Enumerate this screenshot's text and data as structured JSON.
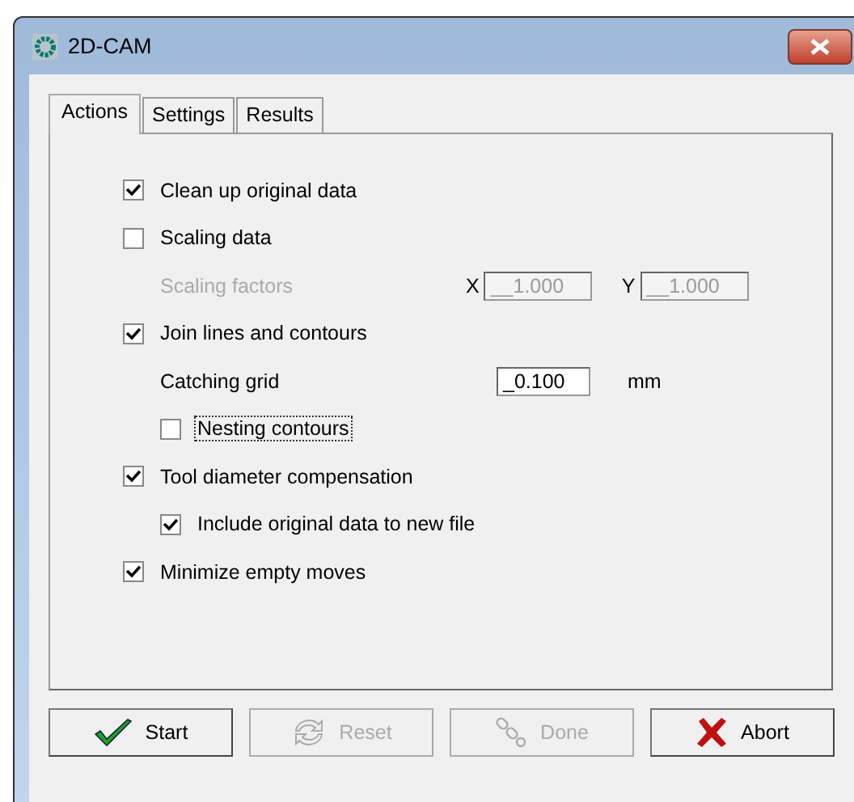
{
  "window": {
    "title": "2D-CAM"
  },
  "tabs": [
    {
      "label": "Actions",
      "selected": true
    },
    {
      "label": "Settings",
      "selected": false
    },
    {
      "label": "Results",
      "selected": false
    }
  ],
  "options": [
    {
      "kind": "checkbox",
      "label": "Clean up original data",
      "checked": true
    },
    {
      "kind": "checkbox",
      "label": "Scaling data",
      "checked": false
    },
    {
      "kind": "pair",
      "label": "Scaling factors",
      "disabled": true,
      "fields": [
        {
          "label": "X",
          "value": "__1.000"
        },
        {
          "label": "Y",
          "value": "__1.000"
        }
      ]
    },
    {
      "kind": "checkbox",
      "label": "Join lines and contours",
      "checked": true,
      "children": [
        {
          "kind": "field",
          "label": "Catching grid",
          "value": "_0.100",
          "unit": "mm"
        },
        {
          "kind": "checkbox",
          "label": "Nesting contours",
          "checked": false,
          "focused": true
        }
      ]
    },
    {
      "kind": "checkbox",
      "label": "Tool diameter compensation",
      "checked": true,
      "children": [
        {
          "kind": "checkbox",
          "label": "Include original data to new file",
          "checked": true
        }
      ]
    },
    {
      "kind": "checkbox",
      "label": "Minimize empty moves",
      "checked": true
    }
  ],
  "buttons": [
    {
      "label": "Start",
      "disabled": false
    },
    {
      "label": "Reset",
      "disabled": true
    },
    {
      "label": "Done",
      "disabled": true
    },
    {
      "label": "Abort",
      "disabled": false
    }
  ]
}
